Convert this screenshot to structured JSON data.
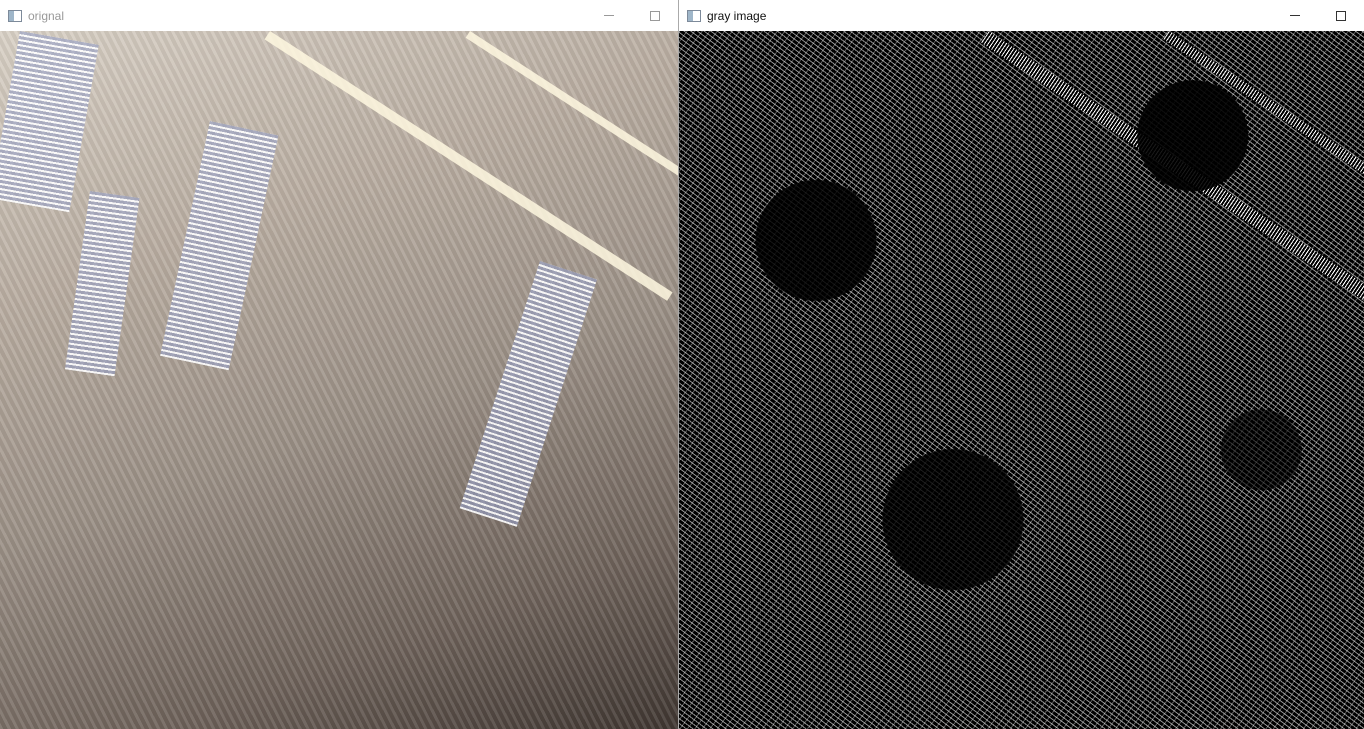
{
  "windows": {
    "original": {
      "title": "orignal",
      "icon": "window-app-icon",
      "controls": {
        "minimize": "minimize-icon",
        "maximize": "maximize-icon"
      }
    },
    "gray": {
      "title": "gray image",
      "icon": "window-app-icon",
      "controls": {
        "minimize": "minimize-icon",
        "maximize": "maximize-icon"
      }
    }
  }
}
